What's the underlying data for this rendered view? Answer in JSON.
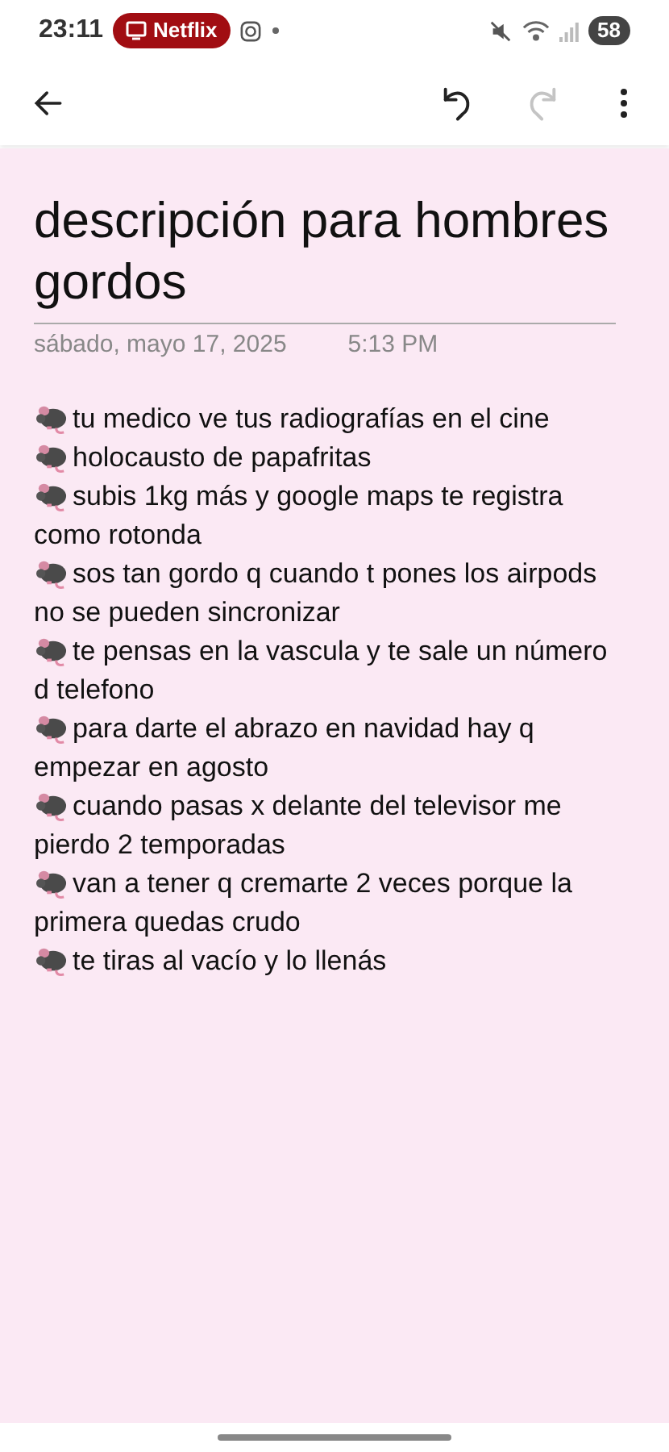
{
  "status_bar": {
    "time": "23:11",
    "notification": "Netflix",
    "battery": "58"
  },
  "toolbar": {
    "undo": {
      "disabled": false
    },
    "redo": {
      "disabled": true
    }
  },
  "note": {
    "title": "descripción para hombres gordos",
    "date": "sábado, mayo 17, 2025",
    "time": "5:13 PM",
    "items": [
      {
        "lines": [
          "tu medico ve tus radiografías en el cine"
        ]
      },
      {
        "lines": [
          "holocausto de papafritas"
        ]
      },
      {
        "lines": [
          "subis 1kg más y google maps te registra",
          "como rotonda"
        ]
      },
      {
        "lines": [
          "sos tan gordo q cuando t pones los airpods",
          "no se pueden sincronizar"
        ]
      },
      {
        "lines": [
          "te pensas en la vascula y te sale un número",
          "d telefono"
        ]
      },
      {
        "lines": [
          "para darte el abrazo en navidad hay q",
          "empezar en agosto"
        ]
      },
      {
        "lines": [
          "cuando pasas x delante del televisor me",
          "pierdo 2 temporadas"
        ]
      },
      {
        "lines": [
          "van a tener q cremarte 2 veces porque la",
          "primera quedas crudo"
        ]
      },
      {
        "lines": [
          "te tiras al vacío y lo llenás"
        ]
      }
    ]
  }
}
